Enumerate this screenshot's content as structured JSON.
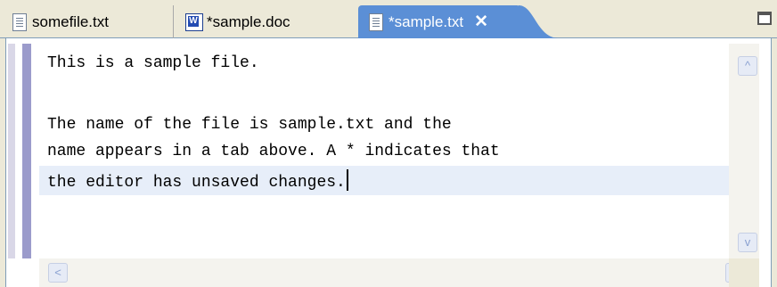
{
  "tabs": [
    {
      "label": "somefile.txt",
      "icon": "text-file-icon",
      "active": false
    },
    {
      "label": "*sample.doc",
      "icon": "word-document-icon",
      "active": false
    },
    {
      "label": "*sample.txt",
      "icon": "text-file-icon",
      "active": true
    }
  ],
  "active_tab": {
    "close_glyph": "✕"
  },
  "editor": {
    "lines": [
      "This is a sample file.",
      "",
      "The name of the file is sample.txt and the",
      "name appears in a tab above. A * indicates that",
      "the editor has unsaved changes."
    ]
  },
  "scrollbars": {
    "up_glyph": "^",
    "down_glyph": "v",
    "left_glyph": "<",
    "right_glyph": ">"
  },
  "colors": {
    "active_tab_bg": "#5b8fd6",
    "current_line_bg": "#e7eef9",
    "chrome_bg": "#ece9d8"
  }
}
